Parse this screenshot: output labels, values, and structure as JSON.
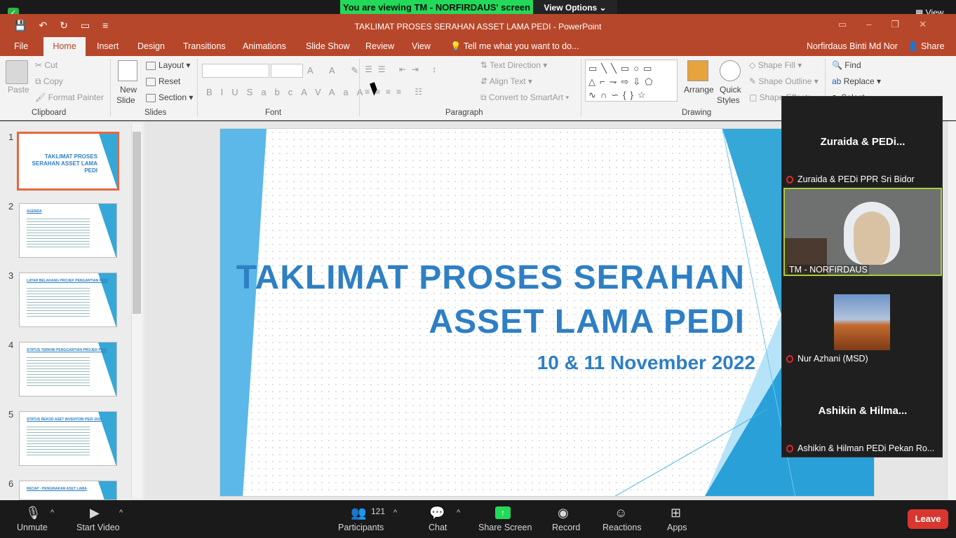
{
  "zoom": {
    "viewing_banner": "You are viewing TM - NORFIRDAUS' screen",
    "view_options": "View Options ⌄",
    "view_top": "View",
    "bottom": {
      "unmute": "Unmute",
      "start_video": "Start Video",
      "participants": "Participants",
      "participants_count": "121",
      "chat": "Chat",
      "share_screen": "Share Screen",
      "record": "Record",
      "reactions": "Reactions",
      "apps": "Apps",
      "leave": "Leave"
    },
    "panel": {
      "p1_name": "Zuraida & PEDi...",
      "p1_label": "Zuraida & PEDi PPR Sri Bidor",
      "p2_label": "TM - NORFIRDAUS",
      "p3_label": "Nur Azhani (MSD)",
      "p4_name": "Ashikin & Hilma...",
      "p4_label": "Ashikin & Hilman PEDi Pekan Ro..."
    }
  },
  "ppt": {
    "title": "TAKLIMAT PROSES SERAHAN ASSET LAMA PEDI  -  PowerPoint",
    "tabs": [
      "File",
      "Home",
      "Insert",
      "Design",
      "Transitions",
      "Animations",
      "Slide Show",
      "Review",
      "View",
      "Tell me what you want to do..."
    ],
    "user": "Norfirdaus Binti Md Nor",
    "share": "Share",
    "ribbon": {
      "paste": "Paste",
      "cut": "Cut",
      "copy": "Copy",
      "format_painter": "Format Painter",
      "clipboard": "Clipboard",
      "new_slide": "New",
      "new_slide2": "Slide",
      "layout": "Layout",
      "reset": "Reset",
      "section": "Section",
      "slides": "Slides",
      "font": "Font",
      "text_direction": "Text Direction",
      "align_text": "Align Text",
      "smartart": "Convert to SmartArt",
      "paragraph": "Paragraph",
      "arrange": "Arrange",
      "quick": "Quick",
      "styles": "Styles",
      "shape_fill": "Shape Fill",
      "shape_outline": "Shape Outline",
      "shape_effects": "Shape Effects",
      "drawing": "Drawing",
      "find": "Find",
      "replace": "Replace",
      "select": "Select"
    },
    "thumbs": [
      {
        "num": "1",
        "title": "TAKLIMAT PROSES SERAHAN ASSET LAMA PEDI"
      },
      {
        "num": "2",
        "title": "AGENDA"
      },
      {
        "num": "3",
        "title": "LATAR BELAKANG PROJEK PENGANTIAN PEDI"
      },
      {
        "num": "4",
        "title": "STATUS TERKINI PENGGANTIAN PROJEK PEDI"
      },
      {
        "num": "5",
        "title": "STATUS REKOD ASET INVENTORI PEDI 2022"
      },
      {
        "num": "6",
        "title": "RECAP - PENGINAKAN ASET LAMA"
      }
    ],
    "slide": {
      "title_line1": "TAKLIMAT PROSES SERAHAN",
      "title_line2": "ASSET LAMA PEDI",
      "subtitle": "10 & 11 November 2022"
    }
  },
  "colors": {
    "ppt_accent": "#b7472a",
    "slide_text": "#2e7fc4",
    "zoom_green": "#23d959",
    "leave_red": "#d9362f"
  }
}
